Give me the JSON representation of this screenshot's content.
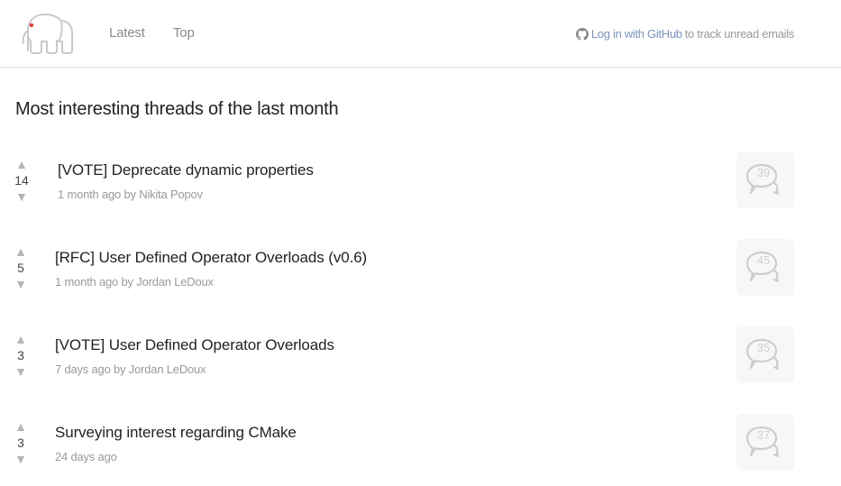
{
  "header": {
    "nav": [
      {
        "label": "Latest"
      },
      {
        "label": "Top"
      }
    ],
    "login": {
      "link_text": "Log in with GitHub",
      "suffix_text": "to track unread emails"
    }
  },
  "page": {
    "title": "Most interesting threads of the last month"
  },
  "threads": [
    {
      "votes": "14",
      "title": "[VOTE] Deprecate dynamic properties",
      "time": "1 month ago",
      "by": "by",
      "author": "Nikita Popov",
      "replies": "39"
    },
    {
      "votes": "5",
      "title": "[RFC] User Defined Operator Overloads (v0.6)",
      "time": "1 month ago",
      "by": "by",
      "author": "Jordan LeDoux",
      "replies": "45"
    },
    {
      "votes": "3",
      "title": "[VOTE] User Defined Operator Overloads",
      "time": "7 days ago",
      "by": "by",
      "author": "Jordan LeDoux",
      "replies": "35"
    },
    {
      "votes": "3",
      "title": "Surveying interest regarding CMake",
      "time": "24 days ago",
      "by": "",
      "author": "",
      "replies": "37"
    }
  ],
  "icons": {
    "logo": "php-elephant-logo",
    "github": "github-icon",
    "vote_up": "upvote-arrow-icon",
    "vote_down": "downvote-arrow-icon",
    "replies": "speech-bubbles-icon"
  },
  "colors": {
    "link_blue": "#7c93bc",
    "muted_text": "#9a9a9a",
    "logo_accent": "#e0443a"
  }
}
